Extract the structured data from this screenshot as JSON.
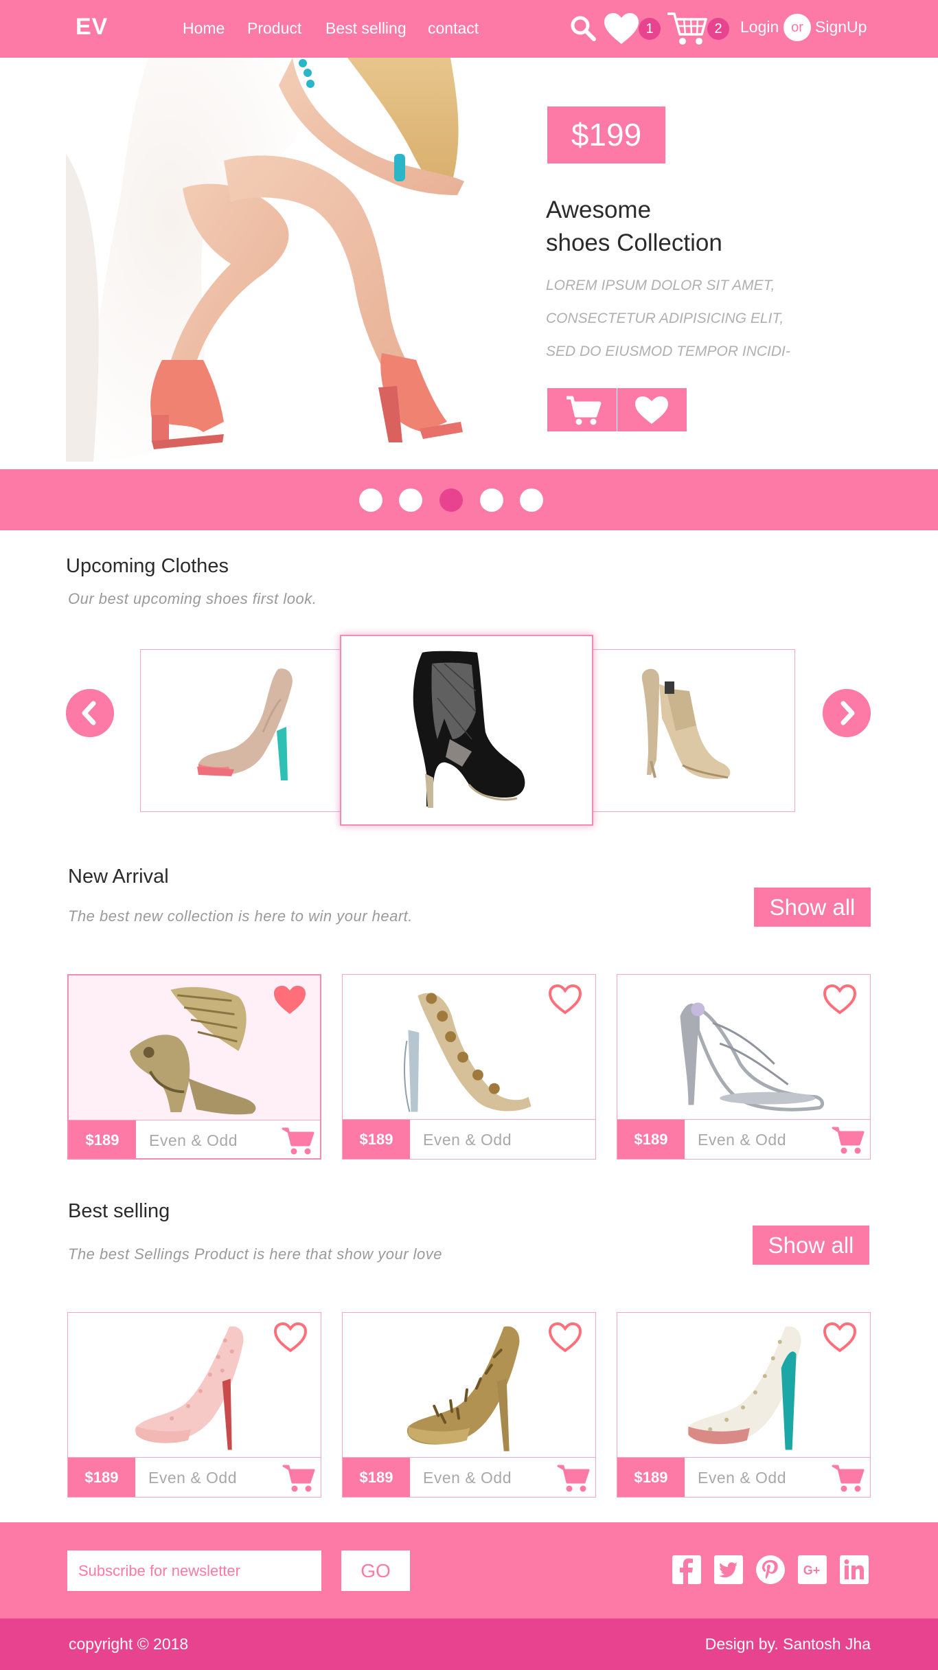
{
  "nav": {
    "logo": "EV",
    "links": [
      "Home",
      "Product",
      "Best selling",
      "contact"
    ],
    "wishlist_count": "1",
    "cart_count": "2",
    "login": "Login",
    "or": "or",
    "signup": "SignUp"
  },
  "hero": {
    "price": "$199",
    "title_line1": "Awesome",
    "title_line2": "shoes Collection",
    "desc_line1": "LOREM IPSUM DOLOR SIT AMET,",
    "desc_line2": "CONSECTETUR ADIPISICING ELIT,",
    "desc_line3": "SED DO EIUSMOD TEMPOR INCIDI-"
  },
  "slider": {
    "dots": 5,
    "active_index": 2
  },
  "upcoming": {
    "title": "Upcoming Clothes",
    "subtitle": "Our best upcoming shoes first look."
  },
  "new_arrival": {
    "title": "New Arrival",
    "subtitle": "The best new collection is here to win your heart.",
    "show_all": "Show all",
    "products": [
      {
        "price": "$189",
        "brand": "Even & Odd",
        "favorited": true
      },
      {
        "price": "$189",
        "brand": "Even & Odd",
        "favorited": false
      },
      {
        "price": "$189",
        "brand": "Even & Odd",
        "favorited": false
      }
    ]
  },
  "best_selling": {
    "title": "Best selling",
    "subtitle": "The best Sellings Product is here that show your love",
    "show_all": "Show all",
    "products": [
      {
        "price": "$189",
        "brand": "Even & Odd",
        "favorited": false
      },
      {
        "price": "$189",
        "brand": "Even & Odd",
        "favorited": false
      },
      {
        "price": "$189",
        "brand": "Even & Odd",
        "favorited": false
      }
    ]
  },
  "footer": {
    "newsletter_placeholder": "Subscribe for newsletter",
    "go": "GO",
    "social": [
      "facebook-icon",
      "twitter-icon",
      "pinterest-icon",
      "google-plus-icon",
      "linkedin-icon"
    ],
    "copyright": "copyright © 2018",
    "designer": "Design by. Santosh Jha"
  },
  "colors": {
    "primary": "#fe7aa6",
    "accent": "#e8438f",
    "heart": "#ff6f7a"
  }
}
